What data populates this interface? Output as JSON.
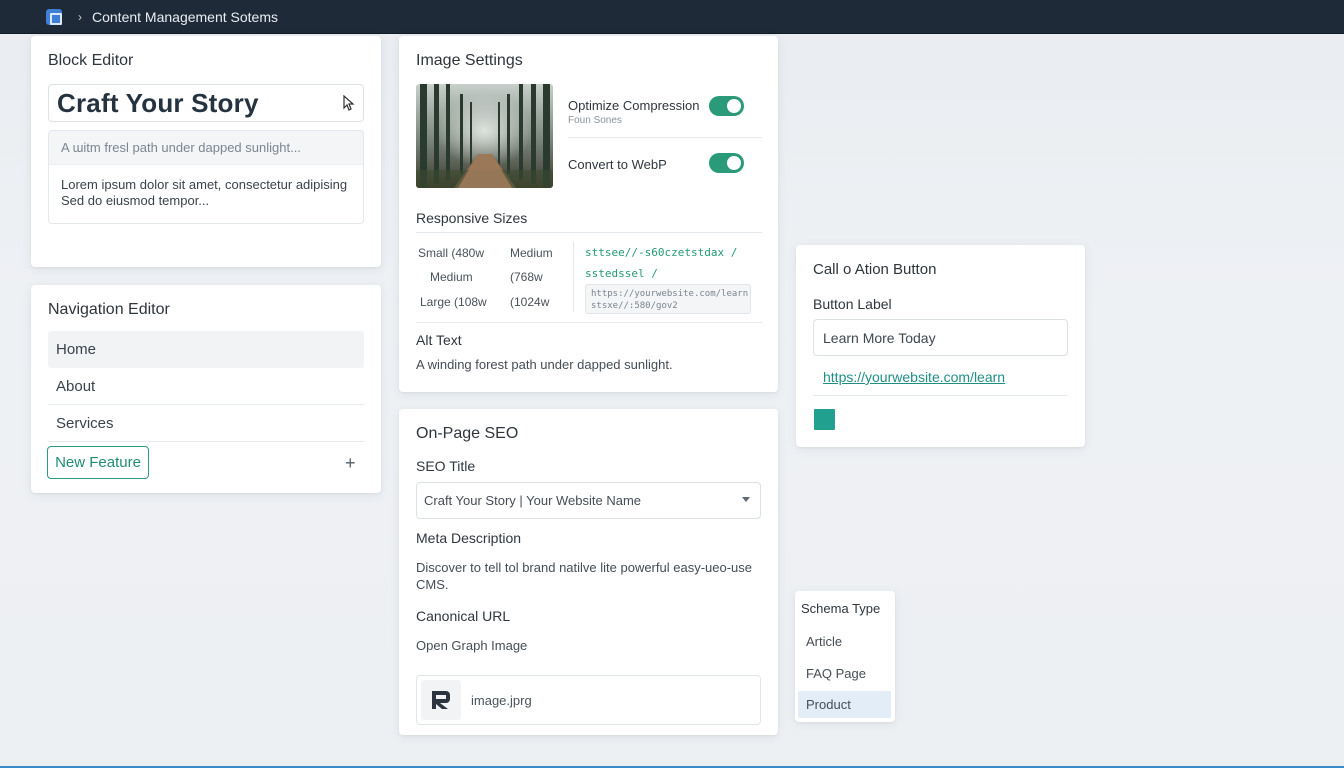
{
  "topbar": {
    "breadcrumb_sep": "›",
    "title": "Content Management Sotems"
  },
  "block_editor": {
    "title": "Block Editor",
    "heading": "Craft Your Story",
    "caption": "A ɯitm fresl path under dapped sunlight...",
    "paragraph_line1": "Lorem ipsum dolor sit amet, consectetur adipising",
    "paragraph_line2": "Sed do eiusmod tempor..."
  },
  "nav_editor": {
    "title": "Navigation Editor",
    "items": [
      {
        "label": "Home"
      },
      {
        "label": "About"
      },
      {
        "label": "Services"
      }
    ],
    "new_button": "New Feature",
    "plus": "+"
  },
  "image_settings": {
    "title": "Image Settings",
    "toggles": [
      {
        "label": "Optimize Compression",
        "sub": "Foun Sones",
        "on": true
      },
      {
        "label": "Convert to WebP",
        "on": true
      }
    ],
    "sizes_title": "Responsive Sizes",
    "sizes": {
      "col1": [
        "Small (480w",
        "Medium",
        "Large (108w"
      ],
      "col2": [
        "Medium",
        "(768w",
        "(1024w"
      ],
      "code1": "sttsee//-s60czetstdax  /",
      "code2": "sstedssel /",
      "url_line1": "https://yourwebsite.com/learn",
      "url_line2": "stsxe//:580/gov2"
    },
    "alt_title": "Alt Text",
    "alt_text": "A winding forest path under dapped sunlight."
  },
  "seo": {
    "title": "On-Page SEO",
    "seo_title_label": "SEO Title",
    "seo_title_value": "Craft Your Story | Your Website Name",
    "meta_label": "Meta Description",
    "meta_value": "Discover to tell tol brand natilve lite powerful easy-ueo-use CMS.",
    "canonical_label": "Canonical URL",
    "og_label": "Open Graph Image",
    "og_file": "image.jprg"
  },
  "cta": {
    "title": "Call o Ation Button",
    "label": "Button Label",
    "value": "Learn More Today",
    "link": "https://yourwebsite.com/learn",
    "swatch_color": "#21a08f"
  },
  "schema": {
    "title": "Schema Type",
    "options": [
      "Article",
      "FAQ Page",
      "Product"
    ],
    "selected": "Product"
  },
  "colors": {
    "accent": "#2a9a85",
    "topbar": "#1f2a38",
    "link": "#1f8f86"
  }
}
